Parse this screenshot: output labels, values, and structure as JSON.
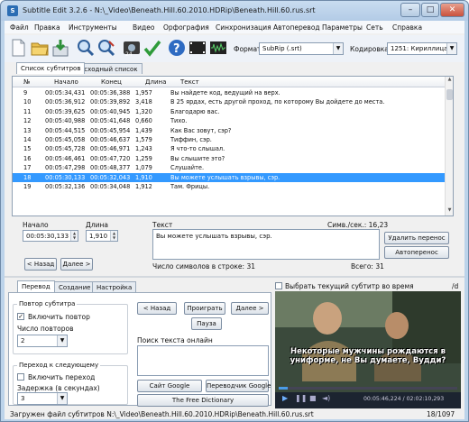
{
  "window": {
    "title": "Subtitle Edit 3.2.6 - N:\\_Video\\Beneath.Hill.60.2010.HDRip\\Beneath.Hill.60.rus.srt"
  },
  "menu": [
    "Файл",
    "Правка",
    "Инструменты",
    "Видео",
    "Орфография",
    "Синхронизация",
    "Автоперевод",
    "Параметры",
    "Сеть",
    "Справка"
  ],
  "toolbar": {
    "icons": [
      "new-file-icon",
      "open-folder-icon",
      "save-icon",
      "find-icon",
      "replace-icon",
      "visual-sync-icon",
      "spell-check-icon",
      "help-icon",
      "video-icon",
      "waveform-icon"
    ],
    "format_label": "Формат",
    "format_value": "SubRip (.srt)",
    "encoding_label": "Кодировка",
    "encoding_value": "1251: Кириллица (",
    "colors": {
      "new": "#f6f7f9",
      "open": "#e7b743",
      "save": "#2d8f3a",
      "find": "#3b78c7",
      "help": "#2e6bc2",
      "check": "#2e9b3a"
    }
  },
  "list_tabs": [
    "Список субтитров",
    "Исходный список"
  ],
  "grid": {
    "columns": [
      "№",
      "Начало",
      "Конец",
      "Длина",
      "Текст"
    ],
    "rows": [
      [
        "9",
        "00:05:34,431",
        "00:05:36,388",
        "1,957",
        "Вы найдете код, ведущий на верх."
      ],
      [
        "10",
        "00:05:36,912",
        "00:05:39,892",
        "3,418",
        "В 25 ярдах, есть другой проход, по которому Вы дойдете до места."
      ],
      [
        "11",
        "00:05:39,625",
        "00:05:40,945",
        "1,320",
        "Благодарю вас."
      ],
      [
        "12",
        "00:05:40,988",
        "00:05:41,648",
        "0,660",
        "Тихо."
      ],
      [
        "13",
        "00:05:44,515",
        "00:05:45,954",
        "1,439",
        "Как Вас зовут, сэр?"
      ],
      [
        "14",
        "00:05:45,058",
        "00:05:46,637",
        "1,579",
        "Тиффин, сэр."
      ],
      [
        "15",
        "00:05:45,728",
        "00:05:46,971",
        "1,243",
        "Я что-то слышал."
      ],
      [
        "16",
        "00:05:46,461",
        "00:05:47,720",
        "1,259",
        "Вы слышите это?"
      ],
      [
        "17",
        "00:05:47,298",
        "00:05:48,377",
        "1,079",
        "Слушайте."
      ],
      [
        "18",
        "00:05:30,133",
        "00:05:32,043",
        "1,910",
        "Вы можете услышать взрывы, сэр."
      ],
      [
        "19",
        "00:05:32,136",
        "00:05:34,048",
        "1,912",
        "Там. Фрицы."
      ]
    ],
    "selected_row": 9
  },
  "edit": {
    "start_label": "Начало",
    "start_value": "00:05:30,133",
    "duration_label": "Длина",
    "duration_value": "1,910",
    "prev_button": "< Назад",
    "next_button": "Далее >",
    "text_label": "Текст",
    "chars_per_sec": "Симв./сек.: 16,23",
    "text_value": "Вы можете услышать взрывы, сэр.",
    "line_length": "Число символов в строке: 31",
    "total": "Всего: 31",
    "delete_translation": "Удалить перенос",
    "auto_break": "Автоперенос"
  },
  "bottom_tabs": [
    "Перевод",
    "Создание",
    "Настройка"
  ],
  "translate": {
    "repeat_group": "Повтор субтитра",
    "enable_repeat": "Включить повтор",
    "enable_repeat_checked": true,
    "repeat_count_label": "Число повторов",
    "repeat_count": "2",
    "next_group": "Переход к следующему",
    "enable_next": "Включить переход",
    "enable_next_checked": false,
    "delay_label": "Задержка (в секундах)",
    "delay_value": "3",
    "back_button": "< Назад",
    "play_button": "Проиграть",
    "forward_button": "Далее >",
    "pause_button": "Пауза",
    "search_label": "Поиск текста онлайн",
    "google_button": "Сайт Google",
    "translator_button": "Переводчик Google",
    "dictionary_button": "The Free Dictionary"
  },
  "video": {
    "select_current_label": "Выбрать текущий субтитр во время воспроизведения",
    "select_current_checked": false,
    "right_tag": "/d",
    "subtitle_line1": "Некоторые мужчины рождаются в",
    "subtitle_line2": "униформе, не Вы думаете, Вудди?",
    "timecode": "00:05:46,224 / 02:02:10,293",
    "progress": 0.048
  },
  "status": {
    "message": "Загружен файл субтитров N:\\_Video\\Beneath.Hill.60.2010.HDRip\\Beneath.Hill.60.rus.srt",
    "position": "18/1097"
  }
}
